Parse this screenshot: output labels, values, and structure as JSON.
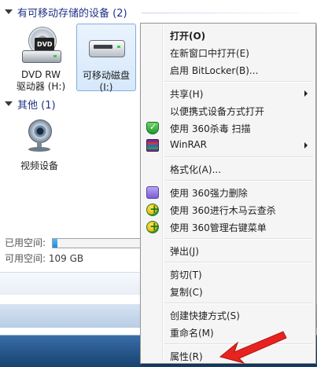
{
  "explorer": {
    "groups": [
      {
        "title": "有可移动存储的设备 (2)"
      },
      {
        "title": "其他 (1)"
      }
    ],
    "drives": [
      {
        "name": "DVD RW",
        "sub": "驱动器 (H:)",
        "icon": "dvd-drive-icon",
        "badge": "DVD"
      },
      {
        "name": "可移动磁盘",
        "sub": "(I:)",
        "icon": "removable-disk-icon"
      }
    ],
    "others": [
      {
        "name": "视频设备",
        "icon": "webcam-icon"
      }
    ],
    "status": {
      "used_label": "已用空间:",
      "free_label": "可用空间:",
      "free_value": "109 GB",
      "used_fraction": 0.05
    }
  },
  "context_menu": {
    "items": [
      {
        "label": "打开(O)",
        "bold": true
      },
      {
        "label": "在新窗口中打开(E)"
      },
      {
        "label": "启用 BitLocker(B)..."
      },
      {
        "separator": true
      },
      {
        "label": "共享(H)",
        "submenu": true
      },
      {
        "label": "以便携式设备方式打开"
      },
      {
        "label": "使用 360杀毒 扫描",
        "icon": "shield-icon"
      },
      {
        "label": "WinRAR",
        "submenu": true,
        "icon": "winrar-icon"
      },
      {
        "separator": true
      },
      {
        "label": "格式化(A)..."
      },
      {
        "separator": true
      },
      {
        "label": "使用 360强力删除",
        "icon": "shredder-icon"
      },
      {
        "label": "使用 360进行木马云查杀",
        "icon": "plus-icon"
      },
      {
        "label": "使用 360管理右键菜单",
        "icon": "plus-icon"
      },
      {
        "separator": true
      },
      {
        "label": "弹出(J)"
      },
      {
        "separator": true
      },
      {
        "label": "剪切(T)"
      },
      {
        "label": "复制(C)"
      },
      {
        "separator": true
      },
      {
        "label": "创建快捷方式(S)"
      },
      {
        "label": "重命名(M)"
      },
      {
        "separator": true
      },
      {
        "label": "属性(R)"
      }
    ]
  },
  "colors": {
    "group_header": "#1e3287",
    "menu_bg": "#f5f5f5",
    "annotation_arrow": "#e8231f"
  }
}
